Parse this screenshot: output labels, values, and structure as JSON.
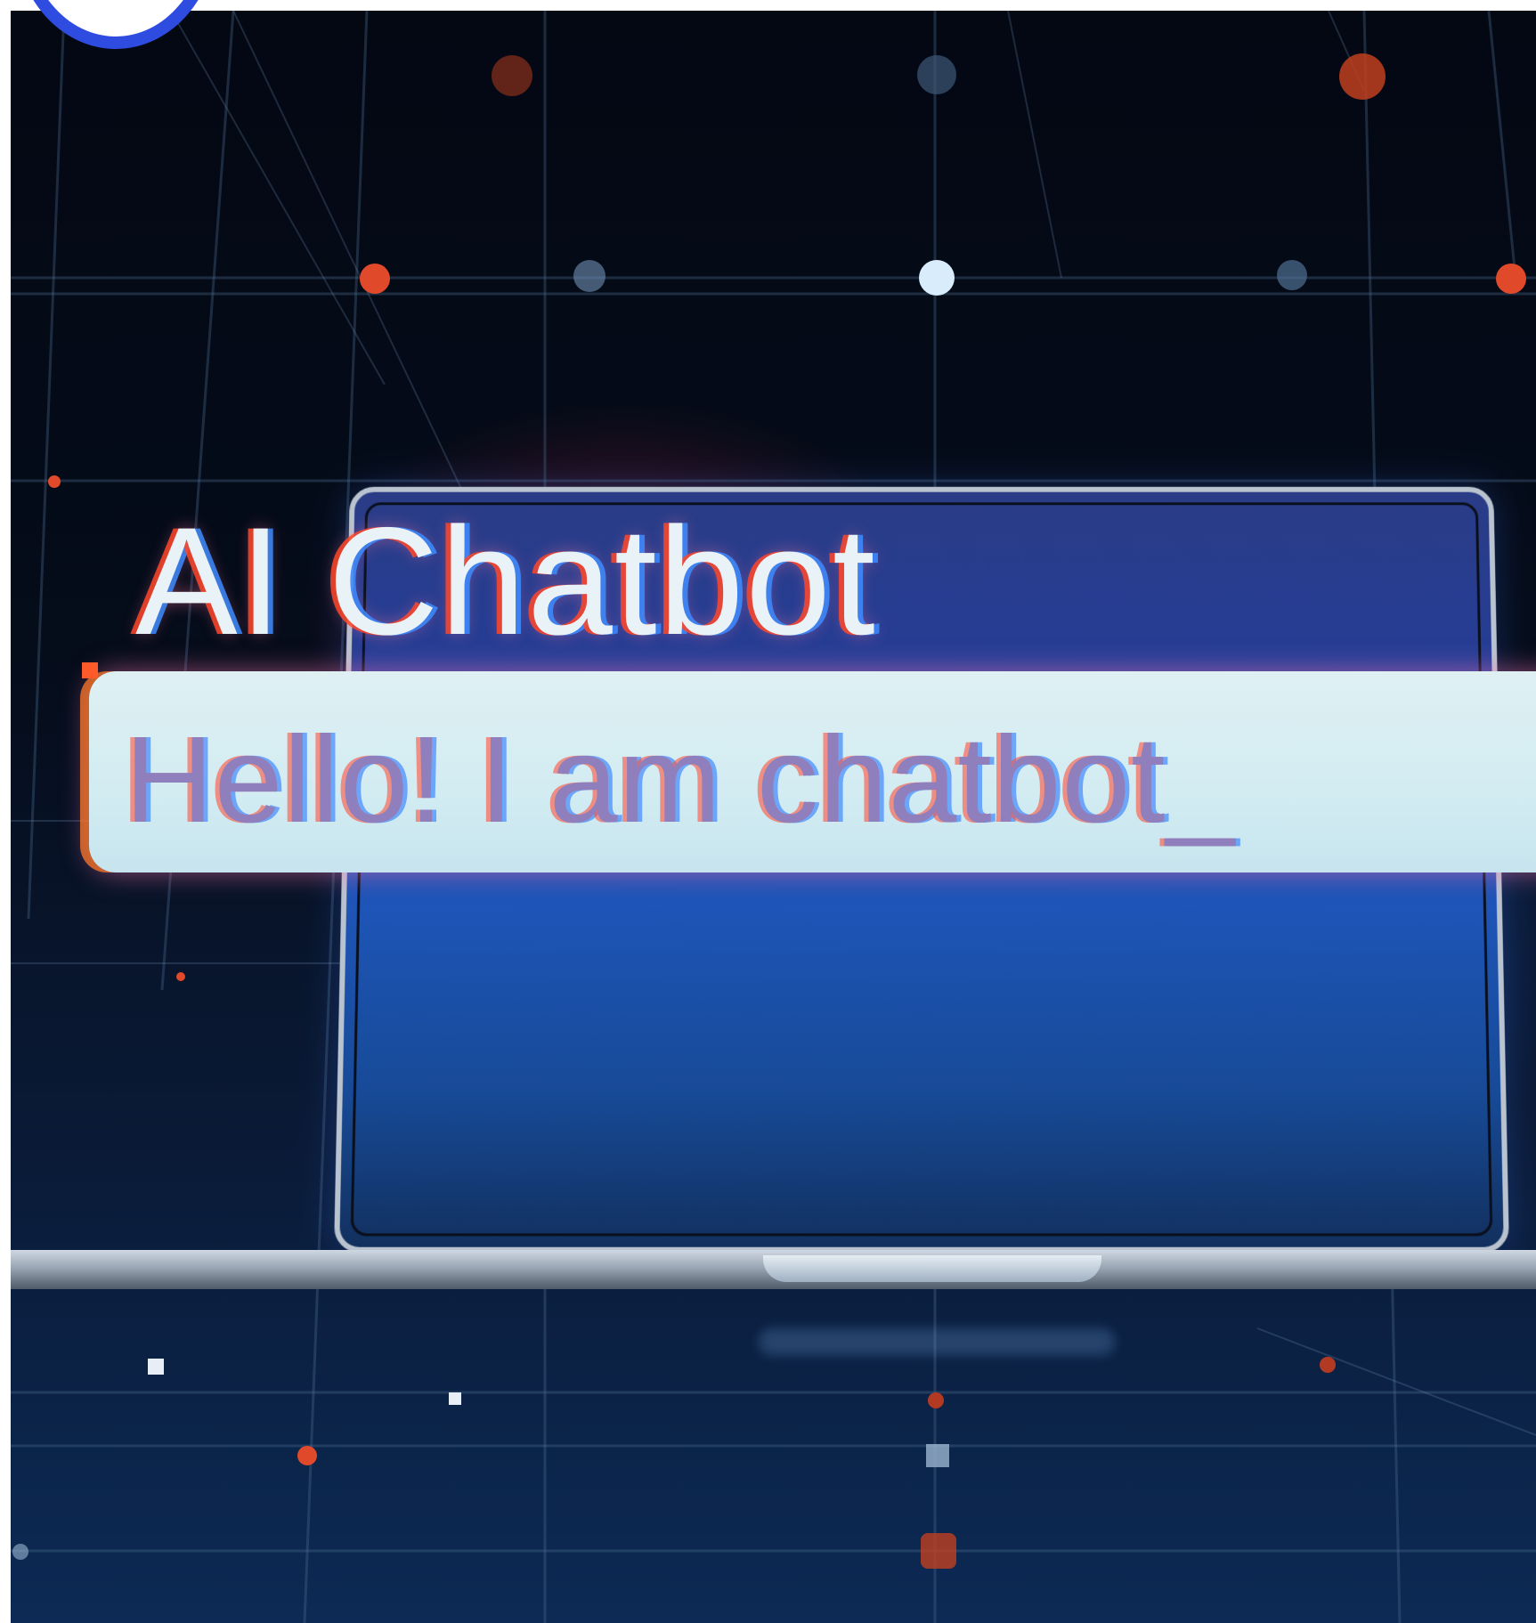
{
  "image": {
    "headline": "AI Chatbot",
    "chat_message": "Hello! I am chatbot_"
  },
  "colors": {
    "background": "#050c1a",
    "screen_blue": "#1e55b8",
    "chat_bar": "#d2ecf2",
    "badge_ring": "#2f4ce0",
    "node_orange": "#e04a2a",
    "node_light": "#cfe4ff"
  }
}
